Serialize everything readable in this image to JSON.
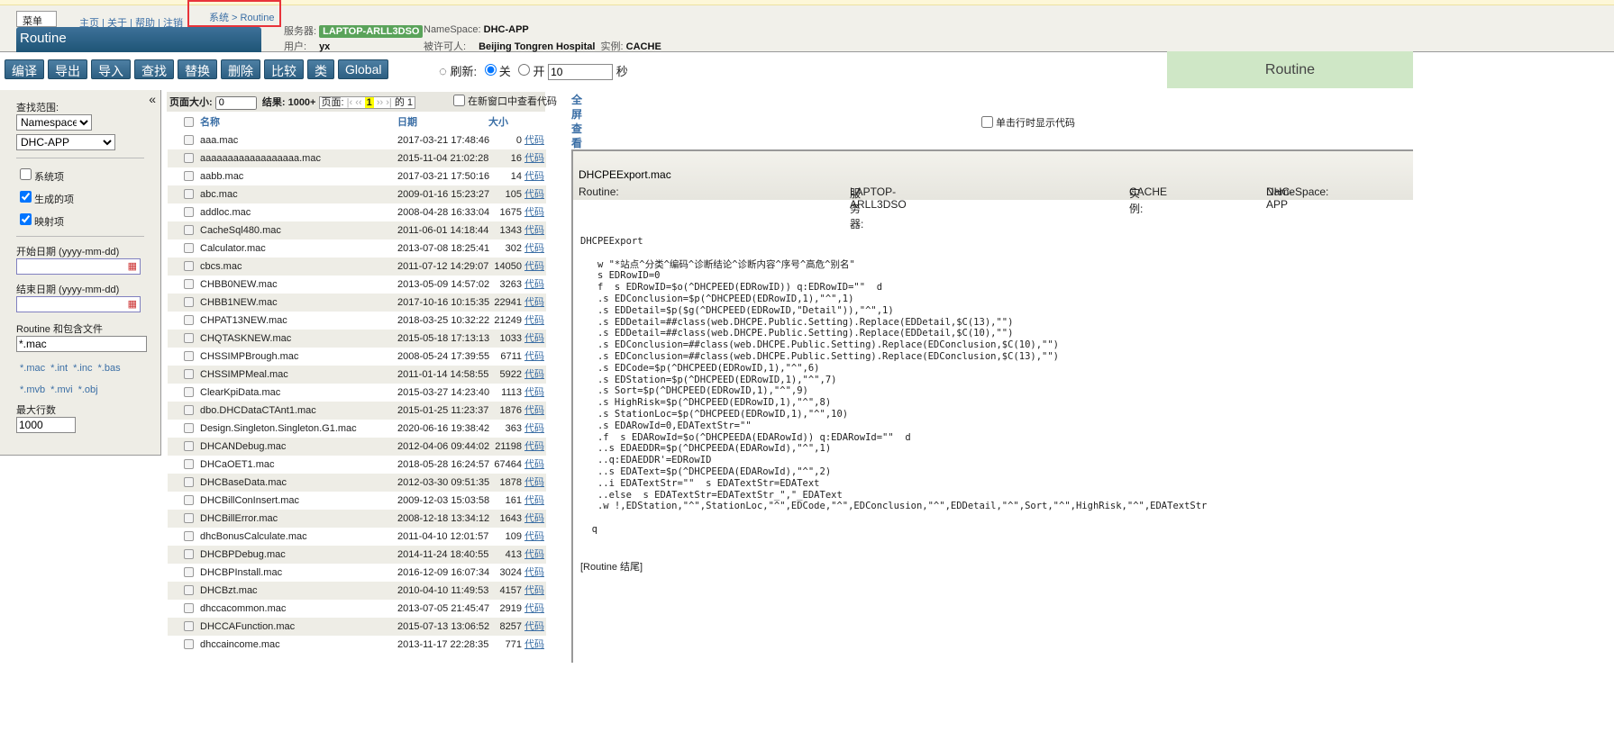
{
  "header": {
    "menu": "菜单",
    "nav": [
      "主页",
      "关于",
      "帮助",
      "注销"
    ],
    "breadcrumb": "系统 > Routine",
    "title": "Routine",
    "server_label": "服务器:",
    "server": "LAPTOP-ARLL3DSO",
    "namespace_label": "NameSpace:",
    "namespace": "DHC-APP",
    "user_label": "用户:",
    "user": "yx",
    "licensee_label": "被许可人:",
    "licensee": "Beijing Tongren Hospital",
    "instance_label": "实例:",
    "instance": "CACHE"
  },
  "toolbar": {
    "buttons": [
      "编译",
      "导出",
      "导入",
      "查找",
      "替换",
      "删除",
      "比较",
      "类",
      "Global"
    ],
    "refresh_label": "刷新:",
    "off": "关",
    "on": "开",
    "refresh_value": "10",
    "seconds": "秒",
    "refresh_on": false
  },
  "right_title": "Routine",
  "left": {
    "collapse": "«",
    "scope_label": "查找范围:",
    "scope": "Namespace",
    "namespace": "DHC-APP",
    "checks": [
      {
        "label": "系统项",
        "checked": false
      },
      {
        "label": "生成的项",
        "checked": true
      },
      {
        "label": "映射项",
        "checked": true
      }
    ],
    "start_label": "开始日期 (yyyy-mm-dd)",
    "end_label": "结束日期 (yyyy-mm-dd)",
    "pattern_label": "Routine 和包含文件",
    "pattern": "*.mac",
    "types1": [
      "*.mac",
      "*.int",
      "*.inc",
      "*.bas"
    ],
    "types2": [
      "*.mvb",
      "*.mvi",
      "*.obj"
    ],
    "max_label": "最大行数",
    "max": "1000"
  },
  "listbar": {
    "page_size_label": "页面大小:",
    "page_size": "0",
    "results": "结果: 1000+",
    "page_label": "页面:",
    "current_page": "1",
    "of": "的 1",
    "new_window": "在新窗口中查看代码"
  },
  "list": {
    "headers": {
      "name": "名称",
      "date": "日期",
      "size": "大小"
    },
    "code_link": "代码",
    "rows": [
      [
        "aaa.mac",
        "2017-03-21 17:48:46",
        "0"
      ],
      [
        "aaaaaaaaaaaaaaaaaa.mac",
        "2015-11-04 21:02:28",
        "16"
      ],
      [
        "aabb.mac",
        "2017-03-21 17:50:16",
        "14"
      ],
      [
        "abc.mac",
        "2009-01-16 15:23:27",
        "105"
      ],
      [
        "addloc.mac",
        "2008-04-28 16:33:04",
        "1675"
      ],
      [
        "CacheSql480.mac",
        "2011-06-01 14:18:44",
        "1343"
      ],
      [
        "Calculator.mac",
        "2013-07-08 18:25:41",
        "302"
      ],
      [
        "cbcs.mac",
        "2011-07-12 14:29:07",
        "14050"
      ],
      [
        "CHBB0NEW.mac",
        "2013-05-09 14:57:02",
        "3263"
      ],
      [
        "CHBB1NEW.mac",
        "2017-10-16 10:15:35",
        "22941"
      ],
      [
        "CHPAT13NEW.mac",
        "2018-03-25 10:32:22",
        "21249"
      ],
      [
        "CHQTASKNEW.mac",
        "2015-05-18 17:13:13",
        "1033"
      ],
      [
        "CHSSIMPBrough.mac",
        "2008-05-24 17:39:55",
        "6711"
      ],
      [
        "CHSSIMPMeal.mac",
        "2011-01-14 14:58:55",
        "5922"
      ],
      [
        "ClearKpiData.mac",
        "2015-03-27 14:23:40",
        "1113"
      ],
      [
        "dbo.DHCDataCTAnt1.mac",
        "2015-01-25 11:23:37",
        "1876"
      ],
      [
        "Design.Singleton.Singleton.G1.mac",
        "2020-06-16 19:38:42",
        "363"
      ],
      [
        "DHCANDebug.mac",
        "2012-04-06 09:44:02",
        "21198"
      ],
      [
        "DHCaOET1.mac",
        "2018-05-28 16:24:57",
        "67464"
      ],
      [
        "DHCBaseData.mac",
        "2012-03-30 09:51:35",
        "1878"
      ],
      [
        "DHCBillConInsert.mac",
        "2009-12-03 15:03:58",
        "161"
      ],
      [
        "DHCBillError.mac",
        "2008-12-18 13:34:12",
        "1643"
      ],
      [
        "dhcBonusCalculate.mac",
        "2011-04-10 12:01:57",
        "109"
      ],
      [
        "DHCBPDebug.mac",
        "2014-11-24 18:40:55",
        "413"
      ],
      [
        "DHCBPInstall.mac",
        "2016-12-09 16:07:34",
        "3024"
      ],
      [
        "DHCBzt.mac",
        "2010-04-10 11:49:53",
        "4157"
      ],
      [
        "dhccacommon.mac",
        "2013-07-05 21:45:47",
        "2919"
      ],
      [
        "DHCCAFunction.mac",
        "2015-07-13 13:06:52",
        "8257"
      ],
      [
        "dhccaincome.mac",
        "2013-11-17 22:28:35",
        "771"
      ]
    ]
  },
  "viewer": {
    "fullscreen": "全屏查看",
    "single_click": "单击行时显示代码",
    "routine_label": "Routine:",
    "routine": "DHCPEExport.mac",
    "server_label": "服务器:",
    "server": "LAPTOP-ARLL3DSO",
    "instance_label": "实例:",
    "instance": "CACHE",
    "namespace_label": "NameSpace:",
    "namespace": "DHC-APP",
    "code": "DHCPEExport\n\n   w \"*站点^分类^编码^诊断结论^诊断内容^序号^高危^别名\"\n   s EDRowID=0\n   f  s EDRowID=$o(^DHCPEED(EDRowID)) q:EDRowID=\"\"  d\n   .s EDConclusion=$p(^DHCPEED(EDRowID,1),\"^\",1)\n   .s EDDetail=$p($g(^DHCPEED(EDRowID,\"Detail\")),\"^\",1)\n   .s EDDetail=##class(web.DHCPE.Public.Setting).Replace(EDDetail,$C(13),\"\")\n   .s EDDetail=##class(web.DHCPE.Public.Setting).Replace(EDDetail,$C(10),\"\")\n   .s EDConclusion=##class(web.DHCPE.Public.Setting).Replace(EDConclusion,$C(10),\"\")\n   .s EDConclusion=##class(web.DHCPE.Public.Setting).Replace(EDConclusion,$C(13),\"\")\n   .s EDCode=$p(^DHCPEED(EDRowID,1),\"^\",6)\n   .s EDStation=$p(^DHCPEED(EDRowID,1),\"^\",7)\n   .s Sort=$p(^DHCPEED(EDRowID,1),\"^\",9)\n   .s HighRisk=$p(^DHCPEED(EDRowID,1),\"^\",8)\n   .s StationLoc=$p(^DHCPEED(EDRowID,1),\"^\",10)\n   .s EDARowId=0,EDATextStr=\"\"\n   .f  s EDARowId=$o(^DHCPEEDA(EDARowId)) q:EDARowId=\"\"  d\n   ..s EDAEDDR=$p(^DHCPEEDA(EDARowId),\"^\",1)\n   ..q:EDAEDDR'=EDRowID\n   ..s EDAText=$p(^DHCPEEDA(EDARowId),\"^\",2)\n   ..i EDATextStr=\"\"  s EDATextStr=EDAText\n   ..else  s EDATextStr=EDATextStr_\",\"_EDAText\n   .w !,EDStation,\"^\",StationLoc,\"^\",EDCode,\"^\",EDConclusion,\"^\",EDDetail,\"^\",Sort,\"^\",HighRisk,\"^\",EDATextStr\n\n  q",
    "end": "[Routine 结尾]"
  }
}
